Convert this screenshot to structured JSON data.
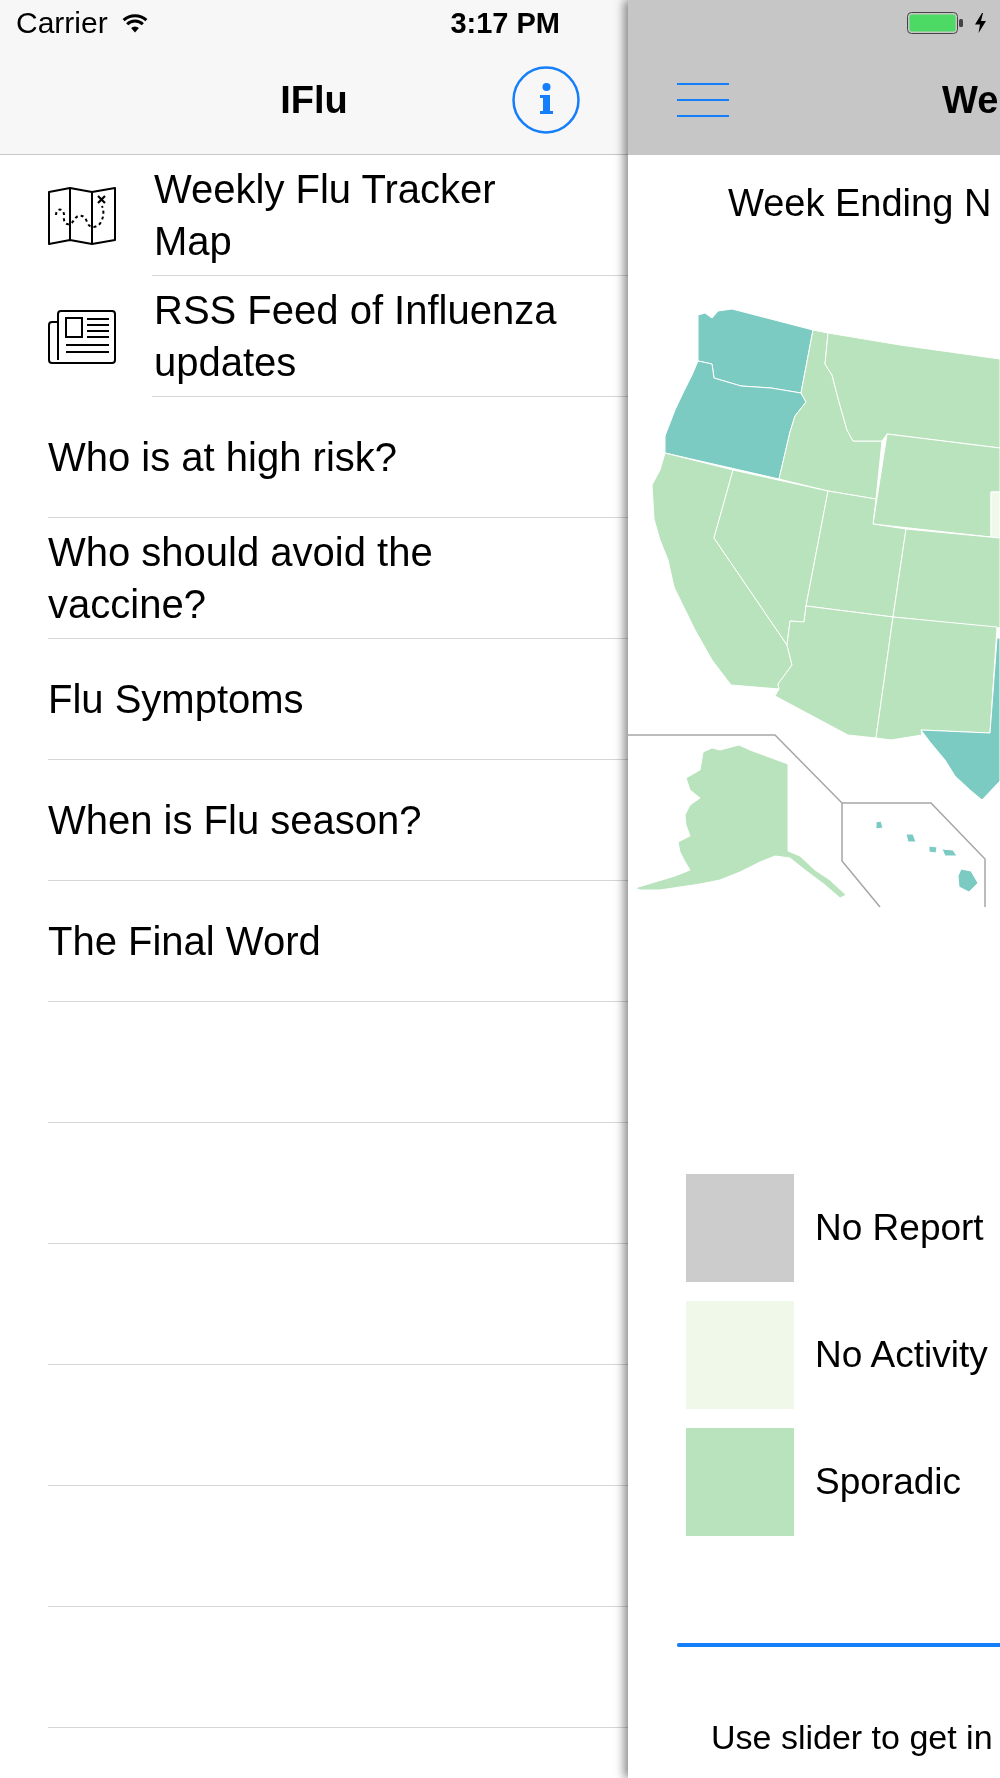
{
  "status_bar": {
    "carrier": "Carrier",
    "time": "3:17 PM"
  },
  "menu": {
    "title": "IFlu",
    "items": [
      {
        "label": "Weekly Flu Tracker Map",
        "kind": "map"
      },
      {
        "label": "RSS Feed of Influenza updates",
        "kind": "news"
      },
      {
        "label": "Who is at high risk?",
        "kind": "plain"
      },
      {
        "label": "Who should avoid the vaccine?",
        "kind": "plain"
      },
      {
        "label": "Flu Symptoms",
        "kind": "plain"
      },
      {
        "label": "When is Flu season?",
        "kind": "plain"
      },
      {
        "label": "The Final Word",
        "kind": "plain"
      }
    ]
  },
  "main": {
    "title": "We",
    "week_label": "Week Ending N",
    "map": {
      "regions": [
        {
          "color": "#7ccbc3"
        },
        {
          "color": "#7ccbc3"
        },
        {
          "color": "#b9e3bc"
        },
        {
          "color": "#b9e3bc"
        },
        {
          "color": "#b9e3bc"
        },
        {
          "color": "#eff8e9"
        },
        {
          "color": "#b9e3bc"
        },
        {
          "color": "#b9e3bc"
        },
        {
          "color": "#b9e3bc"
        },
        {
          "color": "#b9e3bc"
        },
        {
          "color": "#b9e3bc"
        },
        {
          "color": "#b9e3bc"
        },
        {
          "color": "#7ccbc3"
        },
        {
          "color": "#b9e3bc"
        },
        {
          "color": "#7ccbc3"
        }
      ]
    },
    "legend": [
      {
        "label": "No Report",
        "color": "#cccccc"
      },
      {
        "label": "No Activity",
        "color": "#eff8e9"
      },
      {
        "label": "Sporadic",
        "color": "#b9e3bc"
      }
    ],
    "slider": {
      "level": 1
    },
    "hint": "Use slider to get in"
  }
}
